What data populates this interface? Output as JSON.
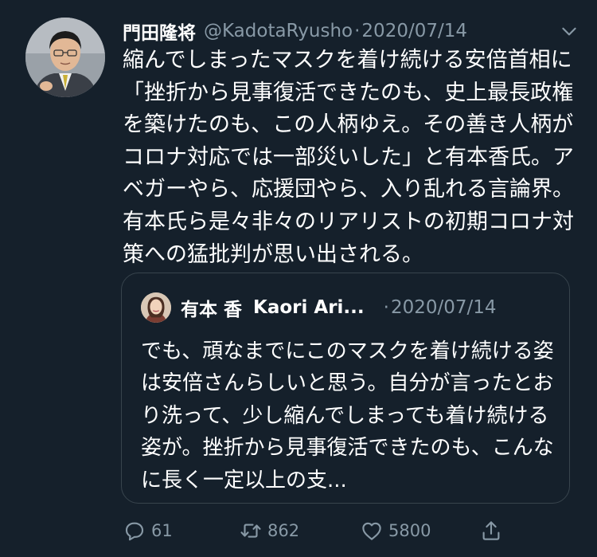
{
  "tweet": {
    "author": {
      "display_name": "門田隆将",
      "handle": "@KadotaRyusho",
      "avatar_icon": "author-avatar"
    },
    "separator": "·",
    "date": "2020/07/14",
    "menu_icon": "chevron-down-icon",
    "text": "縮んでしまったマスクを着け続ける安倍首相に「挫折から見事復活できたのも、史上最長政権を築けたのも、この人柄ゆえ。その善き人柄がコロナ対応では一部災いした」と有本香氏。アベガーやら、応援団やら、入り乱れる言論界。有本氏ら是々非々のリアリストの初期コロナ対策への猛批判が思い出される。",
    "quote": {
      "author_name": "有本 香",
      "author_name_en": "Kaori Ari...",
      "separator": "·",
      "date": "2020/07/14",
      "text": "でも、頑なまでにこのマスクを着け続ける姿は安倍さんらしいと思う。自分が言ったとおり洗って、少し縮んでしまっても着け続ける姿が。挫折から見事復活できたのも、こんなに長く一定以上の支..."
    },
    "actions": {
      "reply_count": "61",
      "retweet_count": "862",
      "like_count": "5800"
    }
  },
  "colors": {
    "background": "#15202b",
    "secondary_text": "#8899a6",
    "border": "#38444d"
  }
}
